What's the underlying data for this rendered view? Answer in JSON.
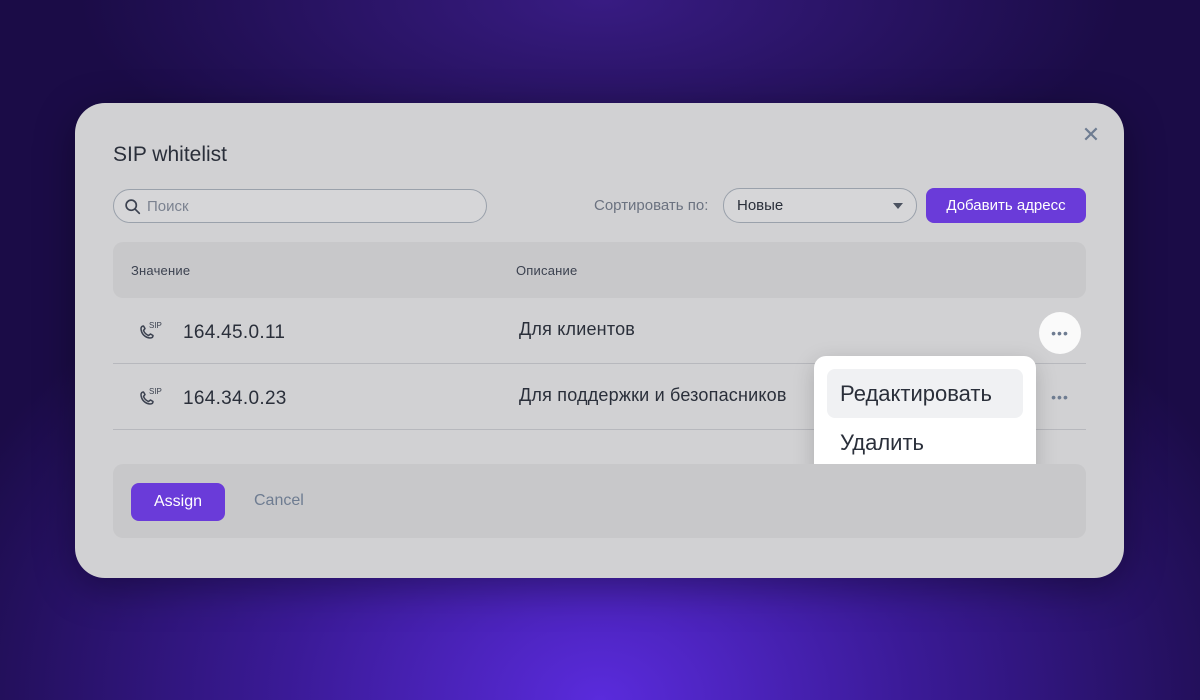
{
  "modal": {
    "title": "SIP whitelist",
    "close_icon": "close-icon"
  },
  "toolbar": {
    "search_placeholder": "Поиск",
    "search_value": "",
    "sort_label": "Сортировать по:",
    "sort_selected": "Новые",
    "add_button": "Добавить адресс"
  },
  "table": {
    "columns": [
      "Значение",
      "Описание"
    ],
    "rows": [
      {
        "icon": "sip-phone-icon",
        "value": "164.45.0.11",
        "description": "Для клиентов"
      },
      {
        "icon": "sip-phone-icon",
        "value": "164.34.0.23",
        "description": "Для поддержки и безопасников"
      }
    ],
    "sip_badge": "SIP"
  },
  "context_menu": {
    "items": [
      "Редактировать",
      "Удалить"
    ]
  },
  "footer": {
    "assign_button": "Assign",
    "cancel_button": "Cancel"
  },
  "colors": {
    "accent": "#6a3bd9",
    "modal_bg": "#d1d1d3"
  }
}
